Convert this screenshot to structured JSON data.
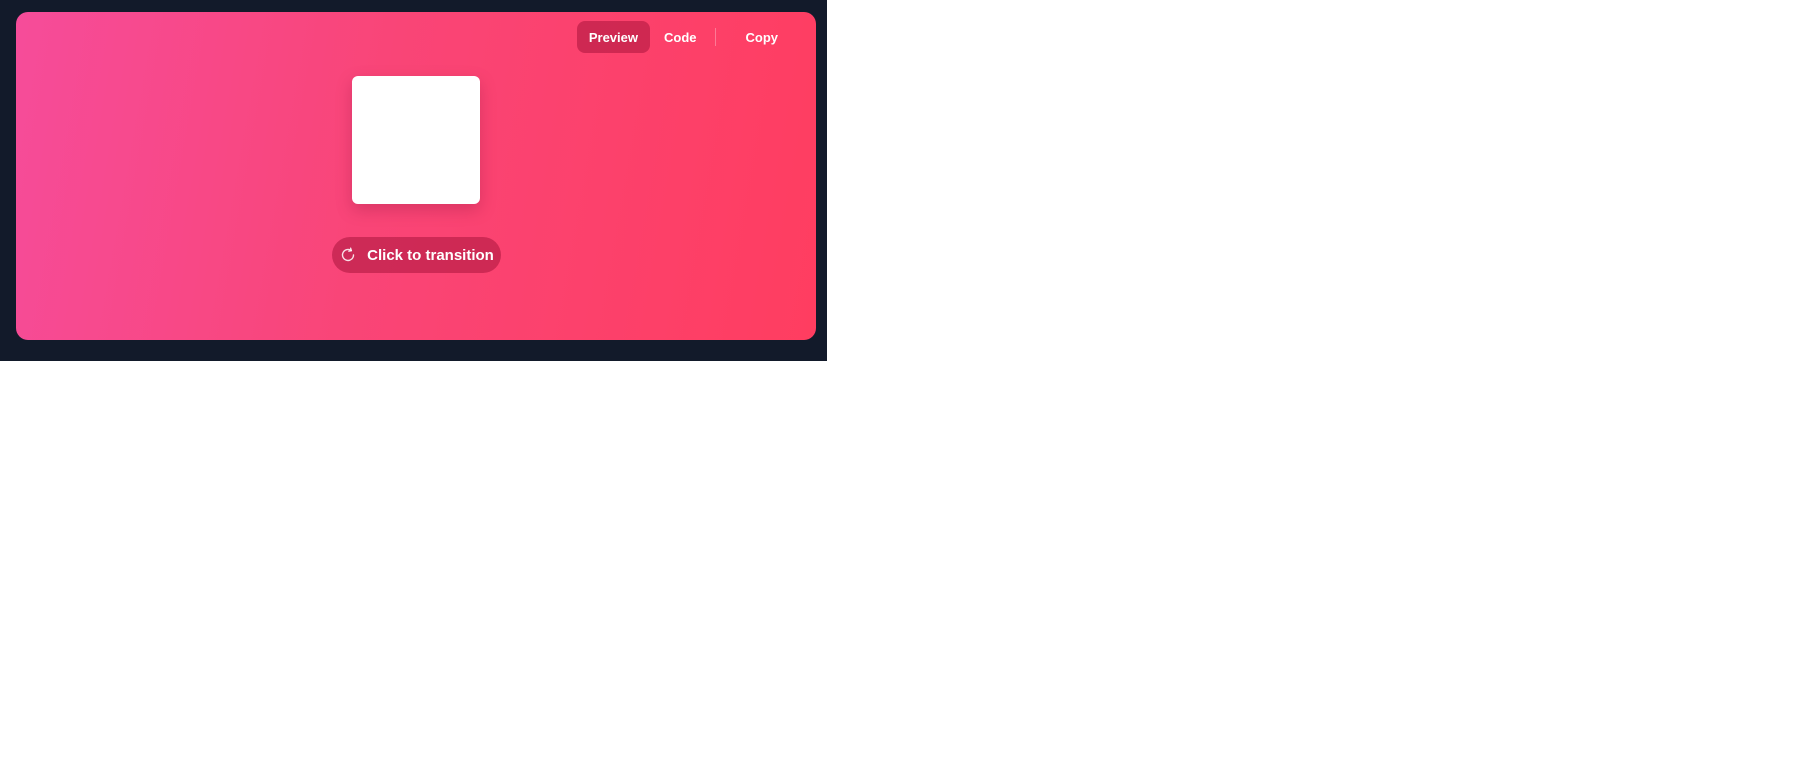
{
  "toolbar": {
    "preview_label": "Preview",
    "code_label": "Code",
    "copy_label": "Copy",
    "active_tab": "Preview"
  },
  "preview": {
    "button_label": "Click to transition",
    "button_icon": "refresh-icon",
    "box_color": "#ffffff"
  },
  "colors": {
    "frame_background": "#121a2a",
    "gradient_start": "#f64c9a",
    "gradient_end": "#ff3d60",
    "active_tab_background": "#c2284f"
  }
}
